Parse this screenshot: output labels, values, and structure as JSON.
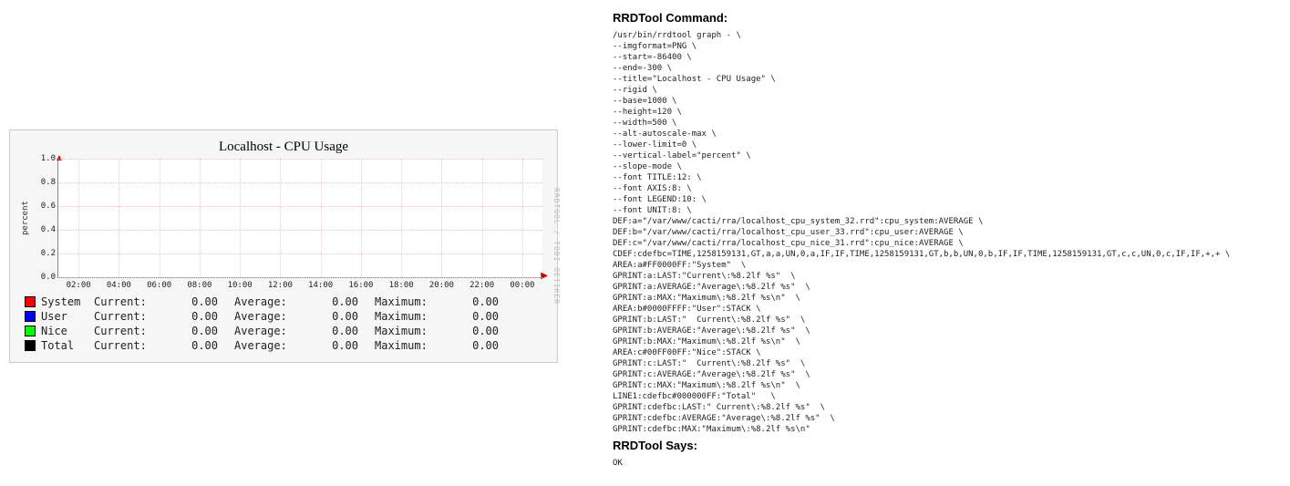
{
  "chart_data": {
    "type": "line",
    "title": "Localhost - CPU Usage",
    "ylabel": "percent",
    "xlabel": "",
    "ylim": [
      0.0,
      1.0
    ],
    "yticks": [
      0.0,
      0.2,
      0.4,
      0.6,
      0.8,
      1.0
    ],
    "xticks": [
      "02:00",
      "04:00",
      "06:00",
      "08:00",
      "10:00",
      "12:00",
      "14:00",
      "16:00",
      "18:00",
      "20:00",
      "22:00",
      "00:00"
    ],
    "series": [
      {
        "name": "System",
        "color": "#FF0000",
        "current": 0.0,
        "average": 0.0,
        "maximum": 0.0
      },
      {
        "name": "User",
        "color": "#0000FF",
        "current": 0.0,
        "average": 0.0,
        "maximum": 0.0
      },
      {
        "name": "Nice",
        "color": "#00FF00",
        "current": 0.0,
        "average": 0.0,
        "maximum": 0.0
      },
      {
        "name": "Total",
        "color": "#000000",
        "current": 0.0,
        "average": 0.0,
        "maximum": 0.0
      }
    ],
    "watermark": "RRDTOOL / TOBI OETIKER"
  },
  "labels": {
    "current": "Current:",
    "average": "Average:",
    "maximum": "Maximum:"
  },
  "right": {
    "heading1": "RRDTool Command:",
    "cmd": "/usr/bin/rrdtool graph - \\\n--imgformat=PNG \\\n--start=-86400 \\\n--end=-300 \\\n--title=\"Localhost - CPU Usage\" \\\n--rigid \\\n--base=1000 \\\n--height=120 \\\n--width=500 \\\n--alt-autoscale-max \\\n--lower-limit=0 \\\n--vertical-label=\"percent\" \\\n--slope-mode \\\n--font TITLE:12: \\\n--font AXIS:8: \\\n--font LEGEND:10: \\\n--font UNIT:8: \\\nDEF:a=\"/var/www/cacti/rra/localhost_cpu_system_32.rrd\":cpu_system:AVERAGE \\\nDEF:b=\"/var/www/cacti/rra/localhost_cpu_user_33.rrd\":cpu_user:AVERAGE \\\nDEF:c=\"/var/www/cacti/rra/localhost_cpu_nice_31.rrd\":cpu_nice:AVERAGE \\\nCDEF:cdefbc=TIME,1258159131,GT,a,a,UN,0,a,IF,IF,TIME,1258159131,GT,b,b,UN,0,b,IF,IF,TIME,1258159131,GT,c,c,UN,0,c,IF,IF,+,+ \\\nAREA:a#FF0000FF:\"System\"  \\\nGPRINT:a:LAST:\"Current\\:%8.2lf %s\"  \\\nGPRINT:a:AVERAGE:\"Average\\:%8.2lf %s\"  \\\nGPRINT:a:MAX:\"Maximum\\:%8.2lf %s\\n\"  \\\nAREA:b#0000FFFF:\"User\":STACK \\\nGPRINT:b:LAST:\"  Current\\:%8.2lf %s\"  \\\nGPRINT:b:AVERAGE:\"Average\\:%8.2lf %s\"  \\\nGPRINT:b:MAX:\"Maximum\\:%8.2lf %s\\n\"  \\\nAREA:c#00FF00FF:\"Nice\":STACK \\\nGPRINT:c:LAST:\"  Current\\:%8.2lf %s\"  \\\nGPRINT:c:AVERAGE:\"Average\\:%8.2lf %s\"  \\\nGPRINT:c:MAX:\"Maximum\\:%8.2lf %s\\n\"  \\\nLINE1:cdefbc#000000FF:\"Total\"   \\\nGPRINT:cdefbc:LAST:\" Current\\:%8.2lf %s\"  \\\nGPRINT:cdefbc:AVERAGE:\"Average\\:%8.2lf %s\"  \\\nGPRINT:cdefbc:MAX:\"Maximum\\:%8.2lf %s\\n\" ",
    "heading2": "RRDTool Says:",
    "says": "OK"
  }
}
